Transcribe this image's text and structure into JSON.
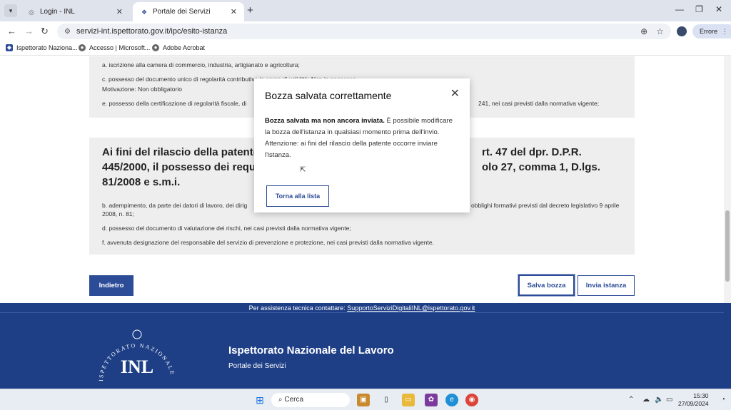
{
  "browser": {
    "tabs": [
      {
        "label": "Login - INL",
        "close": "✕"
      },
      {
        "label": "Portale dei Servizi",
        "close": "✕"
      }
    ],
    "new_tab": "+",
    "url": "servizi-int.ispettorato.gov.it/ipc/esito-istanza",
    "profile_button": "Errore",
    "bookmarks": [
      "Ispettorato Naziona...",
      "Accesso | Microsoft...",
      "Adobe Acrobat"
    ]
  },
  "panel1": {
    "line_a": "a. iscrizione alla camera di commercio, industria, artigianato e agricoltura;",
    "line_c": "c. possesso del documento unico di regolarità contributiva in corso di validità: Non in possesso",
    "motivazione": "Motivazione: Non obbligatorio",
    "line_e_start": "e. possesso della certificazione di regolarità fiscale, di",
    "line_e_end": "241, nei casi previsti dalla normativa vigente;"
  },
  "panel2": {
    "heading_l1": "Ai fini del rilascio della patente",
    "heading_l2": "445/2000, il possesso dei requ",
    "heading_l3": "81/2008 e s.m.i.",
    "heading_r1": "rt. 47 del dpr. D.P.R.",
    "heading_r2": "olo 27, comma 1, D.lgs.",
    "item_b_start": "b. adempimento, da parte dei datori di lavoro, dei dirig",
    "item_b_end": "obblighi formativi previsti dal decreto legislativo 9 aprile",
    "item_b_2": "2008, n. 81;",
    "item_d": "d. possesso del documento di valutazione dei rischi, nei casi previsti dalla normativa vigente;",
    "item_f": "f. avvenuta designazione del responsabile del servizio di prevenzione e protezione, nei casi previsti dalla normativa vigente."
  },
  "buttons": {
    "back": "Indietro",
    "save_draft": "Salva bozza",
    "submit": "Invia istanza"
  },
  "modal": {
    "title": "Bozza salvata correttamente",
    "body_bold": "Bozza salvata ma non ancora inviata.",
    "body_text": " È possibile modificare la bozza dell'istanza in qualsiasi momento prima dell'invio.",
    "attention": "Attenzione: ai fini del rilascio della patente occorre inviare l'istanza.",
    "button": "Torna alla lista",
    "close": "✕"
  },
  "footer": {
    "assist_text": "Per assistenza tecnica contattare: ",
    "assist_email": "SupportoServiziDigitaliINL@ispettorato.gov.it",
    "org_name": "Ispettorato Nazionale del Lavoro",
    "portal_name": "Portale dei Servizi",
    "logo_ring_text": "ISPETTORATO NAZIONALE DEL LAVORO",
    "logo_letters": "INL"
  },
  "taskbar": {
    "search_placeholder": "Cerca",
    "time": "15:30",
    "date": "27/09/2024"
  },
  "colors": {
    "primary": "#2c4c97",
    "footer": "#1e3f86",
    "panel": "#eeeeee"
  }
}
